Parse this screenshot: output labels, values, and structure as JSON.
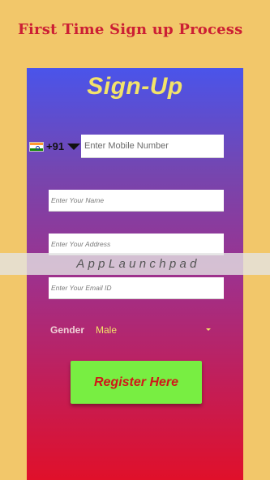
{
  "header": {
    "title": "First Time Sign up Process"
  },
  "screen": {
    "title": "Sign-Up",
    "phone": {
      "country_code": "+91",
      "placeholder": "Enter Mobile Number",
      "flag_icon": "india-flag-icon"
    },
    "fields": {
      "name_placeholder": "Enter Your Name",
      "address_placeholder": "Enter Your Address",
      "email_placeholder": "Enter Your Email ID"
    },
    "gender": {
      "label": "Gender",
      "value": "Male"
    },
    "register_label": "Register Here"
  },
  "watermark": {
    "text": "AppLaunchpad"
  },
  "colors": {
    "page_background": "#f2c76a",
    "heading": "#cc1f34",
    "gradient_top": "#4a54ea",
    "gradient_bottom": "#e0102a",
    "title": "#f3e36a",
    "button": "#78ee42",
    "button_text": "#d01818"
  }
}
